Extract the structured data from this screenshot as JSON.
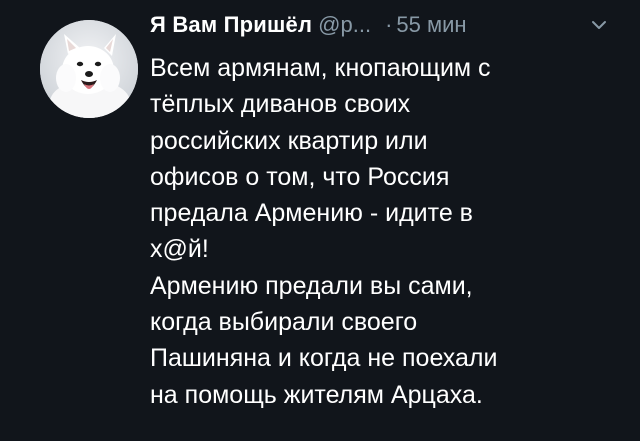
{
  "tweet": {
    "display_name": "Я Вам Пришёл",
    "handle": "@р...",
    "separator": "·",
    "time": "55 мин",
    "menu_icon": "chevron-down-icon",
    "avatar_icon": "arctic-fox-avatar",
    "lines": [
      "Всем армянам, кнопающим с",
      "тёплых диванов своих",
      "российских квартир или",
      "офисов о том, что Россия",
      "предала Армению - идите в",
      "х@й!",
      "Армению предали вы сами,",
      "когда выбирали своего",
      "Пашиняна и когда не поехали",
      "на помощь жителям Арцаха."
    ]
  },
  "colors": {
    "background": "#11151b",
    "text": "#ffffff",
    "secondary": "#8899a6"
  }
}
